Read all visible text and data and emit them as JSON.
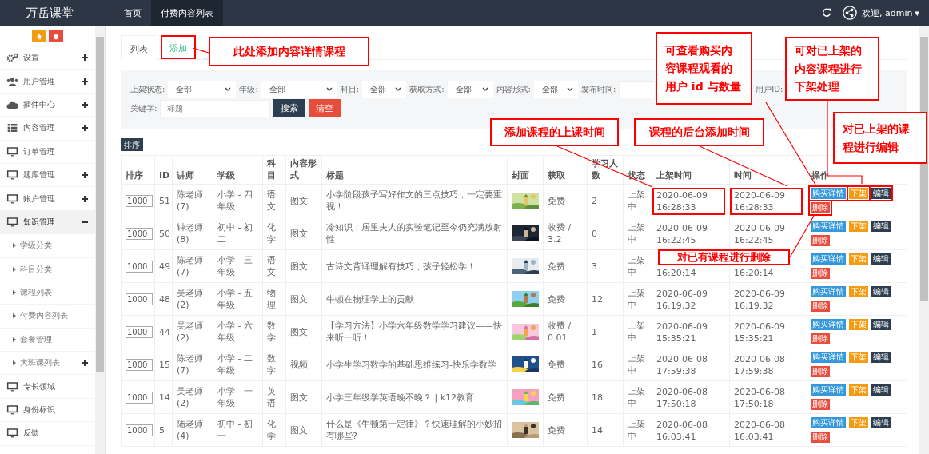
{
  "brand": "万岳课堂",
  "nav": [
    {
      "label": "首页",
      "selected": false
    },
    {
      "label": "付费内容列表",
      "selected": true
    }
  ],
  "user": {
    "greeting": "欢迎, admin",
    "caret": "▾"
  },
  "sidebar": {
    "items": [
      {
        "label": "设置",
        "expandable": true,
        "expanded": false
      },
      {
        "label": "用户管理",
        "expandable": true,
        "expanded": false
      },
      {
        "label": "插件中心",
        "expandable": true,
        "expanded": false
      },
      {
        "label": "内容管理",
        "expandable": true,
        "expanded": false
      },
      {
        "label": "订单管理",
        "expandable": false,
        "expanded": false
      },
      {
        "label": "题库管理",
        "expandable": true,
        "expanded": false
      },
      {
        "label": "账户管理",
        "expandable": true,
        "expanded": false
      },
      {
        "label": "知识管理",
        "expandable": true,
        "expanded": true,
        "children": [
          {
            "label": "学级分类",
            "expandable": false
          },
          {
            "label": "科目分类",
            "expandable": false
          },
          {
            "label": "课程列表",
            "expandable": false
          },
          {
            "label": "付费内容列表",
            "expandable": false
          },
          {
            "label": "套餐管理",
            "expandable": false
          },
          {
            "label": "大班课列表",
            "expandable": true
          }
        ]
      },
      {
        "label": "专长领域",
        "expandable": false,
        "expanded": false
      },
      {
        "label": "身份标识",
        "expandable": false,
        "expanded": false
      },
      {
        "label": "反馈",
        "expandable": false,
        "expanded": false
      }
    ]
  },
  "tabs": [
    {
      "label": "列表",
      "selected": true,
      "highlighted": false
    },
    {
      "label": "添加",
      "selected": false,
      "highlighted": true
    }
  ],
  "filters": [
    {
      "kind": "select",
      "label": "上架状态:",
      "value": "全部"
    },
    {
      "kind": "select",
      "label": "年级:",
      "value": "全部"
    },
    {
      "kind": "select",
      "label": "科目:",
      "value": "全部"
    },
    {
      "kind": "select",
      "label": "获取方式:",
      "value": "全部"
    },
    {
      "kind": "select",
      "label": "内容形式:",
      "value": "全部"
    },
    {
      "kind": "input",
      "label": "发布时间:"
    },
    {
      "kind": "label",
      "label": "用户ID:"
    }
  ],
  "keyword": {
    "label": "关键字:",
    "placeholder": "标题"
  },
  "search_button": "搜索",
  "clear_button": "清空",
  "sort_button": "排序",
  "table": {
    "columns": [
      "排序",
      "ID",
      "讲师",
      "学级",
      "科目",
      "内容形式",
      "标题",
      "封面",
      "获取",
      "学习人数",
      "状态",
      "上架时间",
      "时间",
      "操作"
    ],
    "rows": [
      {
        "sort": "1000",
        "id": "51",
        "teacher": "陈老师 (7)",
        "grade": "小学 - 四年级",
        "subject": "语文",
        "format": "图文",
        "title": "小学阶段孩子写好作文的三点技巧，一定要重视！",
        "access": "免费",
        "learners": "2",
        "status": "上架中",
        "publish_time": "2020-06-09 16:28:33",
        "time": "2020-06-09 16:28:33",
        "highlighted": true,
        "actions": [
          {
            "label": "购买详情",
            "kind": "info"
          },
          {
            "label": "下架",
            "kind": "warning"
          },
          {
            "label": "编辑",
            "kind": "dark"
          },
          {
            "label": "删除",
            "kind": "danger"
          }
        ]
      },
      {
        "sort": "1000",
        "id": "50",
        "teacher": "钟老师 (8)",
        "grade": "初中 - 初二",
        "subject": "化学",
        "format": "图文",
        "title": "冷知识：居里夫人的实验笔记至今仍充满放射性",
        "access": "收费 / 3.2",
        "learners": "0",
        "status": "上架中",
        "publish_time": "2020-06-09 16:22:45",
        "time": "2020-06-09 16:22:45",
        "highlighted": false,
        "actions": [
          {
            "label": "购买详情",
            "kind": "info"
          },
          {
            "label": "下架",
            "kind": "warning"
          },
          {
            "label": "编辑",
            "kind": "dark"
          },
          {
            "label": "删除",
            "kind": "danger"
          }
        ]
      },
      {
        "sort": "1000",
        "id": "49",
        "teacher": "陈老师 (7)",
        "grade": "小学 - 三年级",
        "subject": "语文",
        "format": "图文",
        "title": "古诗文背诵理解有技巧，孩子轻松学！",
        "access": "免费",
        "learners": "3",
        "status": "上架中",
        "publish_time": "16:20:14",
        "time": "16:20:14",
        "highlighted": false,
        "actions": [
          {
            "label": "购买详情",
            "kind": "info"
          },
          {
            "label": "下架",
            "kind": "warning"
          },
          {
            "label": "编辑",
            "kind": "dark"
          },
          {
            "label": "删除",
            "kind": "danger"
          }
        ]
      },
      {
        "sort": "1000",
        "id": "48",
        "teacher": "吴老师 (2)",
        "grade": "小学 - 五年级",
        "subject": "物理",
        "format": "图文",
        "title": "牛顿在物理学上的贡献",
        "access": "免费",
        "learners": "12",
        "status": "上架中",
        "publish_time": "2020-06-09 16:19:32",
        "time": "2020-06-09 16:19:32",
        "highlighted": false,
        "actions": [
          {
            "label": "购买详情",
            "kind": "info"
          },
          {
            "label": "下架",
            "kind": "warning"
          },
          {
            "label": "编辑",
            "kind": "dark"
          },
          {
            "label": "删除",
            "kind": "danger"
          }
        ]
      },
      {
        "sort": "1000",
        "id": "44",
        "teacher": "吴老师 (2)",
        "grade": "小学 - 六年级",
        "subject": "数学",
        "format": "图文",
        "title": "【学习方法】小学六年级数学学习建议——快来听一听！",
        "access": "收费 / 0.01",
        "learners": "1",
        "status": "上架中",
        "publish_time": "2020-06-09 15:35:21",
        "time": "2020-06-09 15:35:21",
        "highlighted": false,
        "actions": [
          {
            "label": "购买详情",
            "kind": "info"
          },
          {
            "label": "下架",
            "kind": "warning"
          },
          {
            "label": "编辑",
            "kind": "dark"
          },
          {
            "label": "删除",
            "kind": "danger"
          }
        ]
      },
      {
        "sort": "1000",
        "id": "15",
        "teacher": "陈老师 (7)",
        "grade": "小学 - 二年级",
        "subject": "数学",
        "format": "视频",
        "title": "小学生学习数学的基础思维练习-快乐学数学",
        "access": "免费",
        "learners": "16",
        "status": "上架中",
        "publish_time": "2020-06-08 17:59:38",
        "time": "2020-06-08 17:59:38",
        "highlighted": false,
        "actions": [
          {
            "label": "购买详情",
            "kind": "info"
          },
          {
            "label": "下架",
            "kind": "warning"
          },
          {
            "label": "编辑",
            "kind": "dark"
          },
          {
            "label": "删除",
            "kind": "danger"
          }
        ]
      },
      {
        "sort": "1000",
        "id": "14",
        "teacher": "吴老师 (2)",
        "grade": "小学 - 一年级",
        "subject": "英语",
        "format": "图文",
        "title": "小学三年级学英语晚不晚？ | k12教育",
        "access": "免费",
        "learners": "18",
        "status": "上架中",
        "publish_time": "2020-06-08 17:50:18",
        "time": "2020-06-08 17:50:18",
        "highlighted": false,
        "actions": [
          {
            "label": "购买详情",
            "kind": "info"
          },
          {
            "label": "下架",
            "kind": "warning"
          },
          {
            "label": "编辑",
            "kind": "dark"
          },
          {
            "label": "删除",
            "kind": "danger"
          }
        ]
      },
      {
        "sort": "1000",
        "id": "5",
        "teacher": "陆老师 (4)",
        "grade": "初中 - 初一",
        "subject": "化学",
        "format": "图文",
        "title": "什么是《牛顿第一定律》？快速理解的小妙招有哪些?",
        "access": "免费",
        "learners": "14",
        "status": "上架中",
        "publish_time": "2020-06-08 16:03:41",
        "time": "2020-06-08 16:03:41",
        "highlighted": false,
        "actions": [
          {
            "label": "购买详情",
            "kind": "info"
          },
          {
            "label": "下架",
            "kind": "warning"
          },
          {
            "label": "编辑",
            "kind": "dark"
          },
          {
            "label": "删除",
            "kind": "danger"
          }
        ]
      }
    ]
  },
  "annotations": [
    {
      "text": "此处添加内容详情课程"
    },
    {
      "text": "可查看购买内容课程观看的用户 id 与数量"
    },
    {
      "text": "可对已上架的内容课程进行下架处理"
    },
    {
      "text": "添加课程的上课时间"
    },
    {
      "text": "课程的后台添加时间"
    },
    {
      "text": "对已上架的课程进行编辑"
    },
    {
      "text": "对已有课程进行删除"
    }
  ]
}
